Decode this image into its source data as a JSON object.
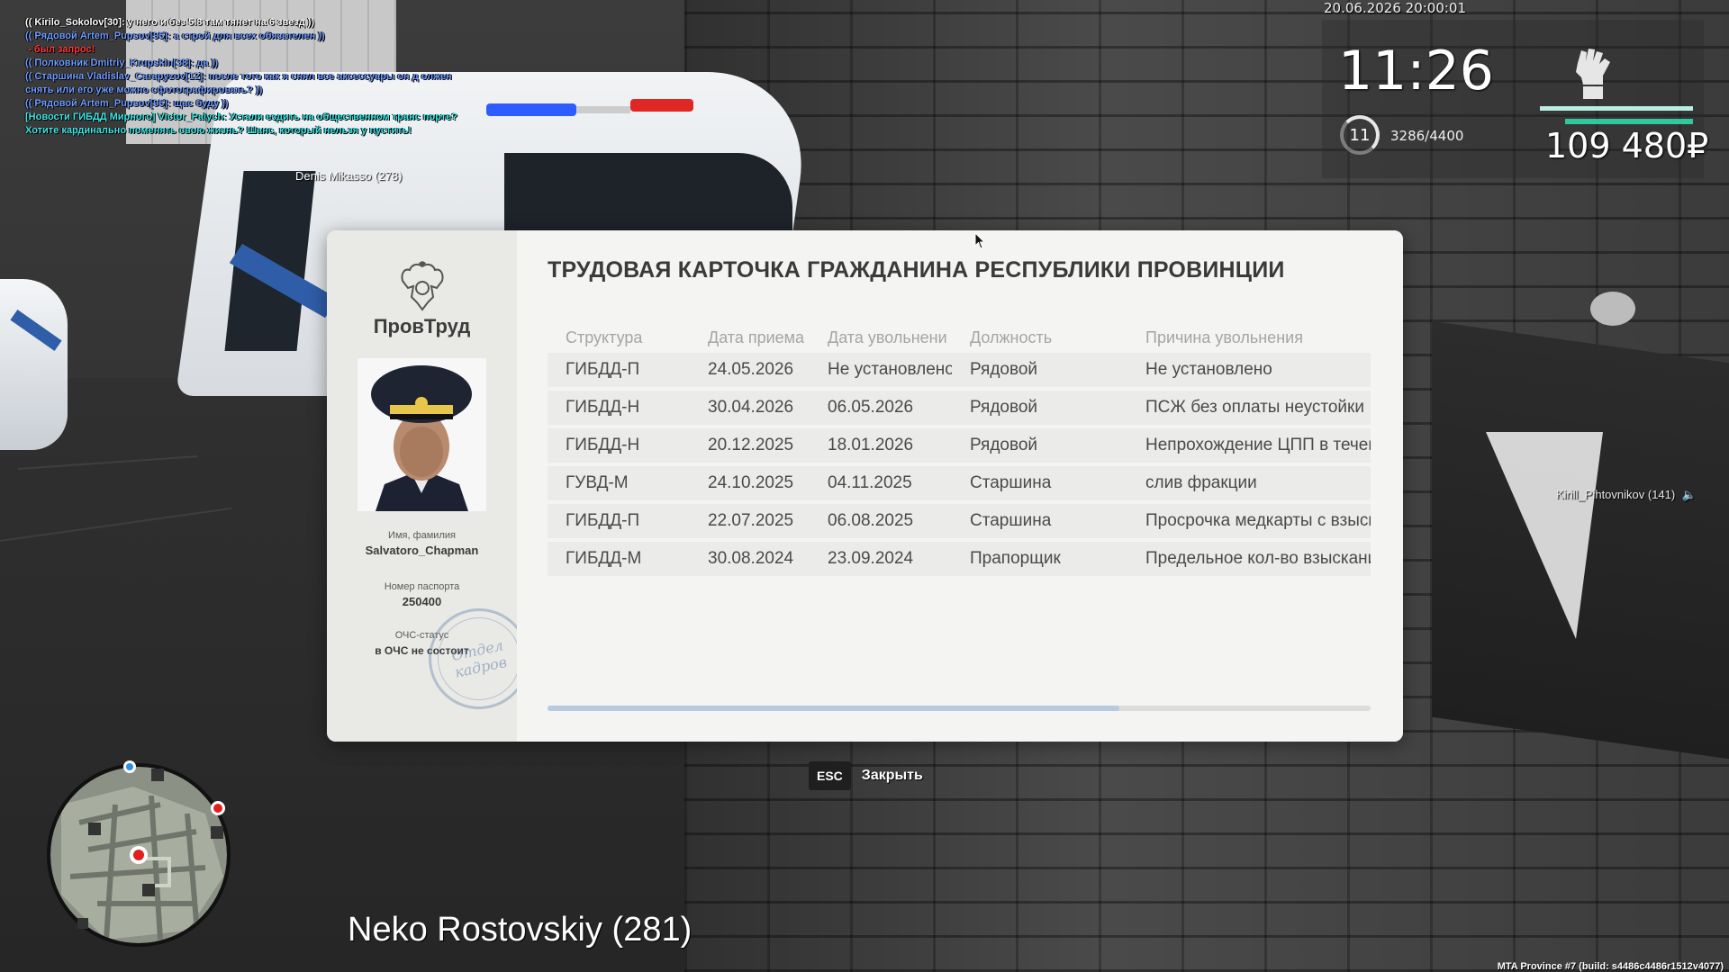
{
  "chat": [
    {
      "text": "(( Kirilo_Sokolov[30]: у него и без 5.8 там тянет на 6 звезд ))",
      "color": "#ffffff"
    },
    {
      "text": "(( Рядовой Artem_Pupsov[95]: а строй для всех обязателен ))",
      "color": "#6f9bff"
    },
    {
      "text": " - был запрос!",
      "color": "#ff3b3b"
    },
    {
      "text": "(( Полковник Dmitriy_Krupskin[38]: да ))",
      "color": "#6f9bff"
    },
    {
      "text": "(( Старшина Vladislav_Carapyzov[12]: после того как я снял все аксессуары он д олжен снять или его уже можно сфотографировать? ))",
      "color": "#6f9bff"
    },
    {
      "text": "(( Рядовой Artem_Pupsov[95]: щас буду ))",
      "color": "#6f9bff"
    },
    {
      "text": "[Новости ГИБДД Мирного] Victor_Palych: Устали ездить на общественном транс порте? Хотите кардинально поменять свою жизнь? Шанс, который нельзя у пустить!",
      "color": "#3fe6e6"
    }
  ],
  "nametags": {
    "denis": "Denis Mikasso (278)",
    "kirill": "Kirill_Pihtovnikov (141)",
    "neko": "Neko Rostovskiy (281)"
  },
  "hud": {
    "date_time": "20.06.2026 20:00:01",
    "clock": "11:26",
    "level": "11",
    "xp": "3286/4400",
    "money": "109 480₽",
    "icon": "fist-icon"
  },
  "card": {
    "org_name": "ПровТруд",
    "emblem_icon": "double-headed-eagle-emblem",
    "name_label": "Имя, фамилия",
    "name_value": "Salvatoro_Chapman",
    "passport_label": "Номер паспорта",
    "passport_value": "250400",
    "ochs_label": "ОЧС-статус",
    "ochs_value": "в ОЧС не состоит",
    "stamp_line1": "Отдел",
    "stamp_line2": "кадров",
    "title": "ТРУДОВАЯ КАРТОЧКА ГРАЖДАНИНА РЕСПУБЛИКИ ПРОВИНЦИИ",
    "columns": [
      "Структура",
      "Дата приема",
      "Дата увольнени",
      "Должность",
      "Причина увольнения"
    ],
    "rows": [
      [
        "ГИБДД-П",
        "24.05.2026",
        "Не установлено",
        "Рядовой",
        "Не установлено"
      ],
      [
        "ГИБДД-Н",
        "30.04.2026",
        "06.05.2026",
        "Рядовой",
        "ПСЖ без оплаты неустойки"
      ],
      [
        "ГИБДД-Н",
        "20.12.2025",
        "18.01.2026",
        "Рядовой",
        "Непрохождение ЦПП в течен"
      ],
      [
        "ГУВД-М",
        "24.10.2025",
        "04.11.2025",
        "Старшина",
        "слив фракции"
      ],
      [
        "ГИБДД-П",
        "22.07.2025",
        "06.08.2025",
        "Старшина",
        "Просрочка медкарты с взыск"
      ],
      [
        "ГИБДД-М",
        "30.08.2024",
        "23.09.2024",
        "Прапорщик",
        "Предельное кол-во взыскани"
      ]
    ],
    "scroll_fraction": 0.695
  },
  "close": {
    "key": "ESC",
    "label": "Закрыть"
  },
  "build_info": "MTA Province #7 (build: s4486c4486r1512v4077)",
  "colors": {
    "accent_green": "#2fc79b",
    "accent_mint": "#b9ede0",
    "scrollbar": "#b6cbe0"
  }
}
